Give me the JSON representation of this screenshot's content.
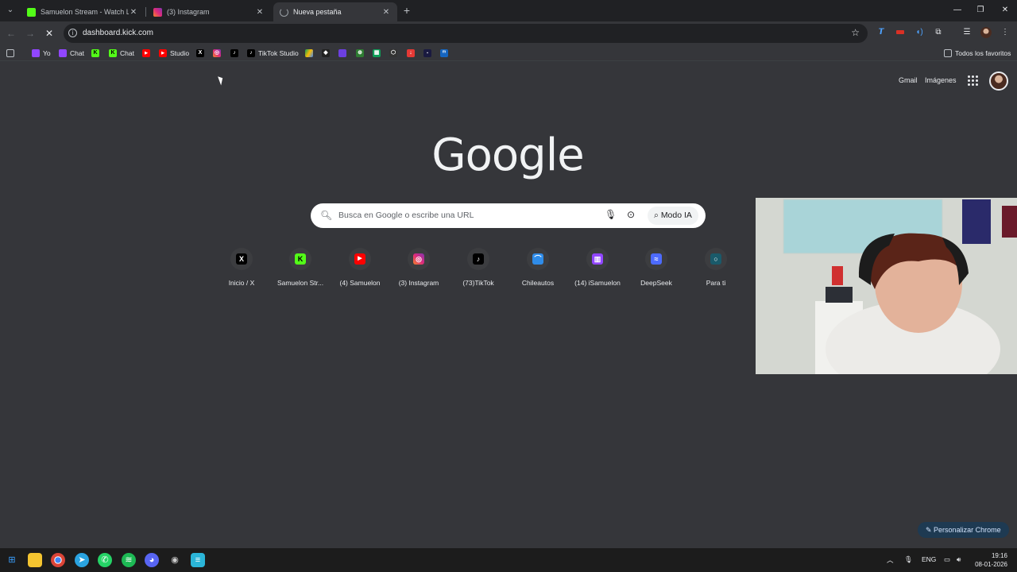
{
  "tabs": [
    {
      "title": "Samuelon Stream - Watch Live",
      "color": "#53fc18"
    },
    {
      "title": "(3) Instagram",
      "color": "#e1306c"
    },
    {
      "title": "Nueva pestaña",
      "color": "#9aa0a6"
    }
  ],
  "toolbar": {
    "url": "dashboard.kick.com"
  },
  "bookmarks": [
    {
      "label": "Yo",
      "icon": "twitch-icon",
      "color": "#9146ff"
    },
    {
      "label": "Chat",
      "icon": "twitch-icon",
      "color": "#9146ff"
    },
    {
      "label": "",
      "icon": "kick-icon",
      "color": "#53fc18"
    },
    {
      "label": "Chat",
      "icon": "kick-icon",
      "color": "#53fc18"
    },
    {
      "label": "",
      "icon": "youtube-icon",
      "color": "#ff0000"
    },
    {
      "label": "Studio",
      "icon": "youtube-icon",
      "color": "#ff0000"
    },
    {
      "label": "",
      "icon": "x-icon",
      "color": "#000000"
    },
    {
      "label": "",
      "icon": "instagram-icon",
      "color": "#e1306c"
    },
    {
      "label": "",
      "icon": "tiktok-icon",
      "color": "#000000"
    },
    {
      "label": "TikTok Studio",
      "icon": "tiktok-icon",
      "color": "#000000"
    }
  ],
  "bookmarks_all": "Todos los favoritos",
  "header_links": {
    "gmail": "Gmail",
    "images": "Imágenes"
  },
  "logo": "Google",
  "search": {
    "placeholder": "Busca en Google o escribe una URL",
    "mode_label": "Modo IA"
  },
  "shortcuts": [
    {
      "label": "Inicio / X",
      "icon": "x-icon",
      "color": "#000000"
    },
    {
      "label": "Samuelon Str...",
      "icon": "kick-icon",
      "color": "#53fc18"
    },
    {
      "label": "(4) Samuelon",
      "icon": "youtube-icon",
      "color": "#ff0000"
    },
    {
      "label": "(3) Instagram",
      "icon": "instagram-icon",
      "color": "#e1306c"
    },
    {
      "label": "(73)TikTok",
      "icon": "tiktok-icon",
      "color": "#000000"
    },
    {
      "label": "Chileautos",
      "icon": "chileautos-icon",
      "color": "#2f8ce8"
    },
    {
      "label": "(14) iSamuelon",
      "icon": "twitch-icon",
      "color": "#9146ff"
    },
    {
      "label": "DeepSeek",
      "icon": "deepseek-icon",
      "color": "#4d6bfe"
    },
    {
      "label": "Para ti",
      "icon": "generic-site-icon",
      "color": "#1a73e8"
    }
  ],
  "customize_label": "Personalizar Chrome",
  "taskbar": {
    "language": "ENG",
    "time": "19:16",
    "date": "08-01-2026"
  }
}
